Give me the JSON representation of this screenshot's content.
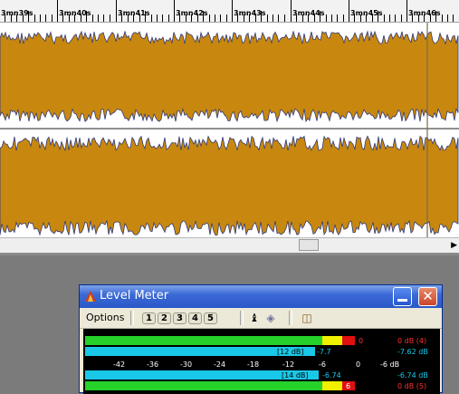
{
  "ruler": {
    "labels": [
      "3mn39s",
      "3mn40s",
      "3mn41s",
      "3mn42s",
      "3mn43s",
      "3mn44s",
      "3mn45s",
      "3mn46s"
    ]
  },
  "level_meter": {
    "title": "Level Meter",
    "options_label": "Options",
    "preset_buttons": [
      "1",
      "2",
      "3",
      "4",
      "5"
    ],
    "icons": [
      "speaker-icon",
      "diamond-icon",
      "book-icon"
    ],
    "scale_ticks": [
      "-42",
      "-36",
      "-30",
      "-24",
      "-18",
      "-12",
      "-6",
      "0",
      "-6 dB"
    ],
    "channels": [
      {
        "peak_label": "[12 dB]",
        "current": "-7.7",
        "clip_marker": "0",
        "peak_right": "0 dB (4)",
        "rms_right": "-7.62 dB",
        "level_percent": 0.68
      },
      {
        "peak_label": "[14 dB]",
        "current": "-6.74",
        "clip_marker": "6",
        "peak_right": "0 dB (5)",
        "rms_right": "-6.74 dB",
        "level_percent": 0.72
      }
    ]
  },
  "colors": {
    "waveform_fill": "#c8880f",
    "waveform_edge": "#303a7a",
    "meter_green": "#25d12a",
    "meter_cyan": "#19c8e8",
    "meter_yellow": "#f0f000",
    "meter_red": "#e01010",
    "titlebar": "#2a58c8"
  }
}
